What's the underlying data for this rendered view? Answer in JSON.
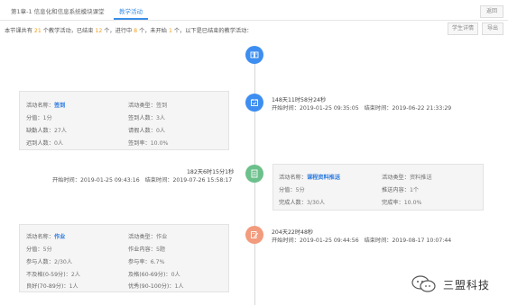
{
  "tabs": [
    {
      "label": "第1章-1 信息化和信息系统模块课堂"
    },
    {
      "label": "教学活动"
    }
  ],
  "toolbar": {
    "back_label": "返回",
    "detail_label": "学生详情",
    "export_label": "导出"
  },
  "summary": {
    "p1": "本节课共有",
    "total": "21",
    "p2": "个教学活动，已结束",
    "ended": "12",
    "p3": "个，进行中",
    "ongoing": "8",
    "p4": "个，未开始",
    "notstarted": "1",
    "p5": "个，以下是已结束的教学活动："
  },
  "activities": [
    {
      "duration": "148天11时58分24秒",
      "start_label": "开始时间：",
      "start": "2019-01-25 09:35:05",
      "end_label": "结束时间：",
      "end": "2019-06-22 21:33:29",
      "rows": [
        [
          "活动名称：",
          "签到",
          "活动类型：",
          "签到"
        ],
        [
          "分值：",
          "1分",
          "签到人数：",
          "3人"
        ],
        [
          "缺勤人数：",
          "27人",
          "请假人数：",
          "0人"
        ],
        [
          "迟到人数：",
          "0人",
          "签到率：",
          "10.0%"
        ]
      ]
    },
    {
      "duration": "182天6时15分1秒",
      "start_label": "开始时间：",
      "start": "2019-01-25 09:43:16",
      "end_label": "结束时间：",
      "end": "2019-07-26 15:58:17",
      "rows": [
        [
          "活动名称：",
          "课程资料推送",
          "活动类型：",
          "资料推送"
        ],
        [
          "分值：",
          "5分",
          "推送内容：",
          "1个"
        ],
        [
          "完成人数：",
          "3/30人",
          "完成率：",
          "10.0%"
        ]
      ]
    },
    {
      "duration": "204天22时48秒",
      "start_label": "开始时间：",
      "start": "2019-01-25 09:44:56",
      "end_label": "结束时间：",
      "end": "2019-08-17 10:07:44",
      "rows": [
        [
          "活动名称：",
          "作业",
          "活动类型：",
          "作业"
        ],
        [
          "分值：",
          "5分",
          "作业内容：",
          "5题"
        ],
        [
          "参与人数：",
          "2/30人",
          "参与率：",
          "6.7%"
        ],
        [
          "不及格(0-59分)：",
          "2人",
          "及格(60-69分)：",
          "0人"
        ],
        [
          "良好(70-89分)：",
          "1人",
          "优秀(90-100分)：",
          "1人"
        ]
      ]
    }
  ],
  "watermark": {
    "text": "三盟科技"
  },
  "colors": {
    "accent": "#3a8ee6",
    "node_blue": "#3d8ef0",
    "node_green": "#6cc08b",
    "node_orange": "#f29b7d",
    "count": "#f39c12"
  }
}
